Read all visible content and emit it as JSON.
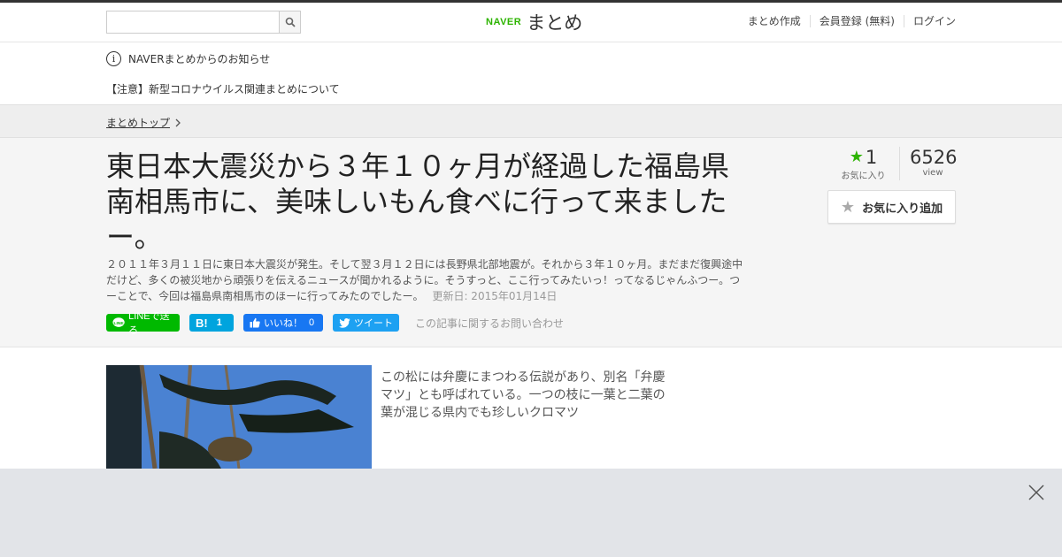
{
  "header": {
    "search_placeholder": "",
    "logo_naver": "NAVER",
    "logo_matome": "まとめ",
    "nav": [
      "まとめ作成",
      "会員登録 (無料)",
      "ログイン"
    ]
  },
  "notice": {
    "heading": "NAVERまとめからのお知らせ",
    "link": "【注意】新型コロナウイルス関連まとめについて"
  },
  "breadcrumb": {
    "label": "まとめトップ"
  },
  "article": {
    "title": "東日本大震災から３年１０ヶ月が経過した福島県南相馬市に、美味しいもん食べに行って来ましたー。",
    "description": "２０１１年３月１１日に東日本大震災が発生。そして翌３月１２日には長野県北部地震が。それから３年１０ヶ月。まだまだ復興途中だけど、多くの被災地から頑張りを伝えるニュースが聞かれるように。そうすっと、ここ行ってみたいっ！ってなるじゃんふつー。つーことで、今回は福島県南相馬市のほーに行ってみたのでしたー。",
    "updated": "更新日: 2015年01月14日"
  },
  "share": {
    "line": "LINEで送る",
    "hatena_count": "1",
    "fb_label": "いいね！",
    "fb_count": "0",
    "tweet": "ツイート",
    "inquiry": "この記事に関するお問い合わせ"
  },
  "stats": {
    "favorites": "1",
    "favorites_label": "お気に入り",
    "views": "6526",
    "views_label": "view",
    "fav_button": "お気に入り追加"
  },
  "content": {
    "caption": "この松には弁慶にまつわる伝説があり、別名「弁慶マツ」とも呼ばれている。一つの枝に一葉と二葉の葉が混じる県内でも珍しいクロマツ"
  },
  "colors": {
    "naver_green": "#2db400",
    "line_green": "#00b900",
    "hatena_blue": "#00a4de",
    "facebook_blue": "#1877f2",
    "twitter_blue": "#1da1f2"
  }
}
